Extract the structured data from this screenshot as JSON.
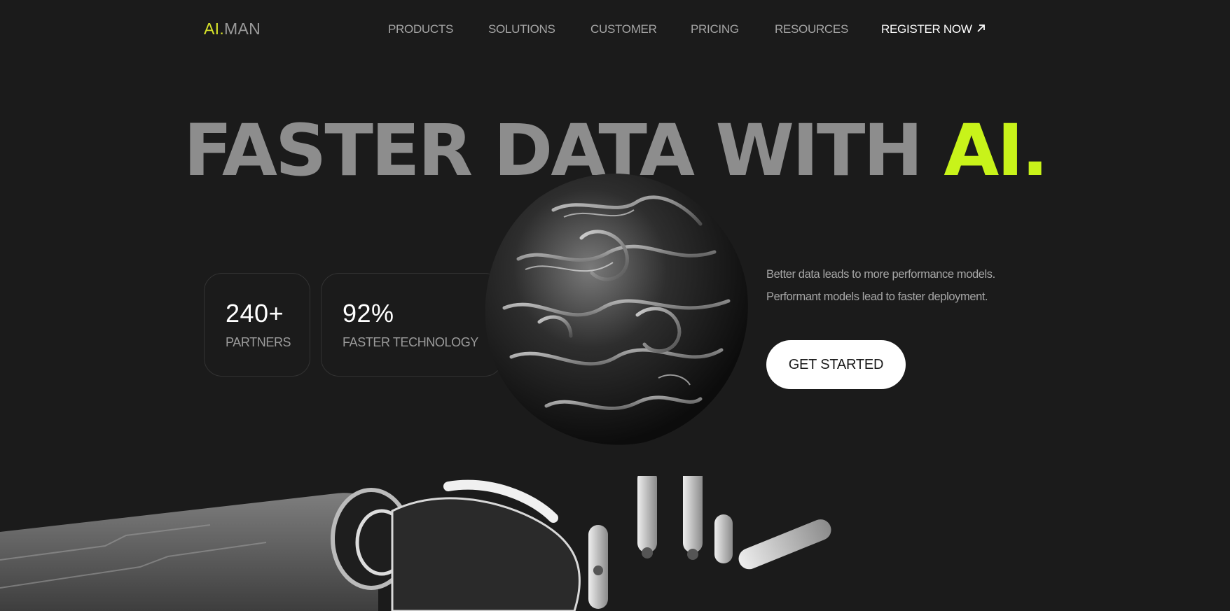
{
  "brand": {
    "accent": "AI.",
    "rest": "MAN",
    "accent_color": "#d6e22a"
  },
  "nav": {
    "items": [
      {
        "label": "PRODUCTS"
      },
      {
        "label": "SOLUTIONS"
      },
      {
        "label": "CUSTOMER"
      },
      {
        "label": "PRICING"
      },
      {
        "label": "RESOURCES"
      }
    ],
    "register_label": "REGISTER NOW",
    "register_icon": "arrow-up-right-icon"
  },
  "hero": {
    "headline_main": "FASTER DATA WITH",
    "headline_accent": "AI.",
    "accent_color": "#c8f31a",
    "tagline_line1": "Better data leads to more performance models.",
    "tagline_line2": "Performant models lead to faster deployment.",
    "cta_label": "GET STARTED"
  },
  "stats": [
    {
      "value": "240+",
      "label": "PARTNERS"
    },
    {
      "value": "92%",
      "label": "FASTER TECHNOLOGY"
    }
  ],
  "images": {
    "sphere": "chrome-blob-sphere",
    "hand": "robotic-hand"
  }
}
